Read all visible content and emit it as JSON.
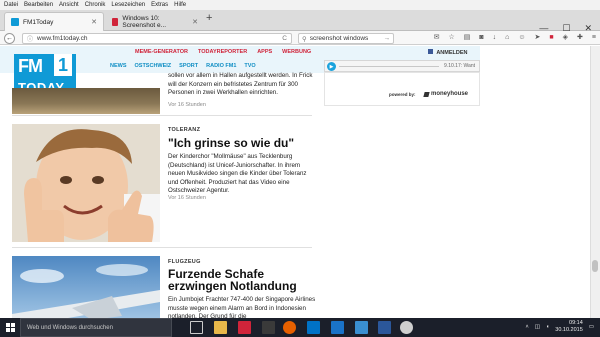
{
  "menubar": {
    "items": [
      "Datei",
      "Bearbeiten",
      "Ansicht",
      "Chronik",
      "Lesezeichen",
      "Extras",
      "Hilfe"
    ]
  },
  "tabs": [
    {
      "title": "FM1Today",
      "active": true,
      "favicon_color": "#0f9ad6"
    },
    {
      "title": "Windows 10: Screenshot e...",
      "active": false,
      "favicon_color": "#d0243a"
    }
  ],
  "window_controls": {
    "minimize": "—",
    "maximize": "☐",
    "close": "✕"
  },
  "navbar": {
    "url": "www.fm1today.ch",
    "search_value": "screenshot windows",
    "reload": "C"
  },
  "site": {
    "top_links": [
      "MEME-GENERATOR",
      "TODAYREPORTER",
      "APPS",
      "WERBUNG"
    ],
    "sub_nav": [
      "NEWS",
      "OSTSCHWEIZ",
      "SPORT",
      "RADIO FM1",
      "TVO"
    ],
    "login": "ANMELDEN",
    "logo_top": "FM",
    "logo_one": "1",
    "logo_bottom": "TODAY",
    "player_text": "9.10.17: Want",
    "powered_by": "powered by:",
    "moneyhouse": "moneyhouse"
  },
  "articles": [
    {
      "category": "",
      "title": "",
      "lead": "sollen vor allem in Hallen aufgestellt werden. In Frick will der Konzern ein befristetes Zentrum für 300 Personen in zwei Werkhallen einrichten.",
      "time": "Vor 16 Stunden"
    },
    {
      "category": "TOLERANZ",
      "title": "\"Ich grinse so wie du\"",
      "lead": "Der Kinderchor \"Mollmäuse\" aus Tecklenburg (Deutschland) ist Unicef-Juniorschafter. In ihrem neuen Musikvideo singen die Kinder über Toleranz und Offenheit. Produziert hat das Video eine Ostschweizer Agentur.",
      "time": "Vor 16 Stunden"
    },
    {
      "category": "FLUGZEUG",
      "title": "Furzende Schafe erzwingen Notlandung",
      "lead": "Ein Jumbojet Frachter 747-400 der Singapore Airlines musste wegen einem Alarm an Bord in Indonesien notlanden. Der Grund für die",
      "time": ""
    }
  ],
  "taskbar": {
    "search_placeholder": "Web und Windows durchsuchen",
    "time": "09:14",
    "date": "30.10.2015"
  }
}
